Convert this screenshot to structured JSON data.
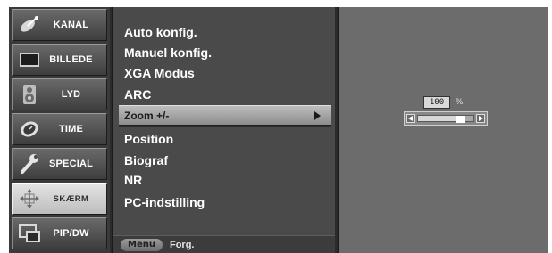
{
  "categories": [
    {
      "label": "KANAL",
      "icon": "satellite-dish-icon",
      "selected": false
    },
    {
      "label": "BILLEDE",
      "icon": "monitor-icon",
      "selected": false
    },
    {
      "label": "LYD",
      "icon": "speaker-icon",
      "selected": false
    },
    {
      "label": "TIME",
      "icon": "clock-icon",
      "selected": false
    },
    {
      "label": "SPECIAL",
      "icon": "wrench-icon",
      "selected": false
    },
    {
      "label": "SKÆRM",
      "icon": "screen-adjust-icon",
      "selected": true
    },
    {
      "label": "PIP/DW",
      "icon": "pip-icon",
      "selected": false
    }
  ],
  "submenu": {
    "items": [
      {
        "label": "Auto konfig.",
        "selected": false
      },
      {
        "label": "Manuel konfig.",
        "selected": false
      },
      {
        "label": "XGA Modus",
        "selected": false
      },
      {
        "label": "ARC",
        "selected": false
      },
      {
        "label": "Zoom +/-",
        "selected": true
      },
      {
        "label": "Position",
        "selected": false
      },
      {
        "label": "Biograf",
        "selected": false
      },
      {
        "label": "NR",
        "selected": false
      },
      {
        "label": "PC-indstilling",
        "selected": false
      }
    ],
    "footer": {
      "menu_key": "Menu",
      "text": "Forg."
    }
  },
  "zoom": {
    "value": "100",
    "unit": "%",
    "level_fraction": 0.85
  },
  "colors": {
    "osd_background": "#2b2b2b",
    "selected_category": "#d6d6d6",
    "selected_item": "#a5a5a5",
    "panel": "#6c6c6c"
  }
}
